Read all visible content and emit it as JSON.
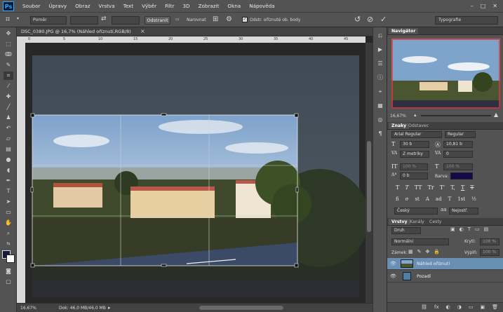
{
  "app": {
    "logo": "Ps"
  },
  "menu": [
    "Soubor",
    "Úpravy",
    "Obraz",
    "Vrstva",
    "Text",
    "Výběr",
    "Filtr",
    "3D",
    "Zobrazit",
    "Okna",
    "Nápověda"
  ],
  "window_controls": {
    "minimize": "–",
    "maximize": "□",
    "close": "✕"
  },
  "options": {
    "ratio_select": "Poměr",
    "clear_button": "Odstranit",
    "straighten_label": "Narovnat",
    "delete_cropped_label": "Odstr. oříznuté ob. body",
    "workspace_select": "Typografie"
  },
  "document": {
    "tab_title": "DSC_0380.JPG @ 16,7% (Náhled oříznutí,RGB/8)",
    "zoom": "16,67%",
    "doc_info": "Dok: 46,0 MB/46,0 MB",
    "ruler_marks": [
      "0",
      "5",
      "10",
      "15",
      "20",
      "25",
      "30",
      "35",
      "40",
      "45",
      "50"
    ]
  },
  "navigator": {
    "tab": "Navigátor",
    "zoom": "16,67%"
  },
  "character": {
    "tabs": [
      "Znaky",
      "Odstavec"
    ],
    "font_family": "Arial Regular",
    "font_style": "Regular",
    "font_size": "30 b",
    "leading": "10,81 b",
    "kerning": "Z metriky",
    "tracking": "0",
    "vscale": "100 %",
    "hscale": "100 %",
    "baseline": "0 b",
    "color_label": "Barva:",
    "text_color": "#14094a",
    "type_buttons": [
      "T",
      "T",
      "TT",
      "Tr",
      "T'",
      "T,",
      "T",
      "T"
    ],
    "ot_buttons": [
      "fi",
      "σ",
      "st",
      "A",
      "ad",
      "T",
      "1st",
      "½"
    ],
    "language": "Český",
    "antialias": "Nejostř."
  },
  "layers": {
    "tabs": [
      "Vrstvy",
      "Kanály",
      "Cesty"
    ],
    "filter": "Druh",
    "blend_mode": "Normální",
    "opacity_label": "Krytí:",
    "opacity": "100 %",
    "lock_label": "Zámek:",
    "fill_label": "Výplň:",
    "fill": "100 %",
    "items": [
      {
        "name": "Náhled oříznutí",
        "selected": true
      },
      {
        "name": "Pozadí",
        "selected": false
      }
    ],
    "footer_icons": [
      "⛓",
      "fx",
      "◐",
      "◑",
      "▭",
      "▣",
      "🗑"
    ]
  },
  "colors": {
    "accent": "#4d7fa8",
    "ui": "#535353",
    "selected_layer": "#6a8fb5",
    "nav_frame": "#e0383a"
  }
}
